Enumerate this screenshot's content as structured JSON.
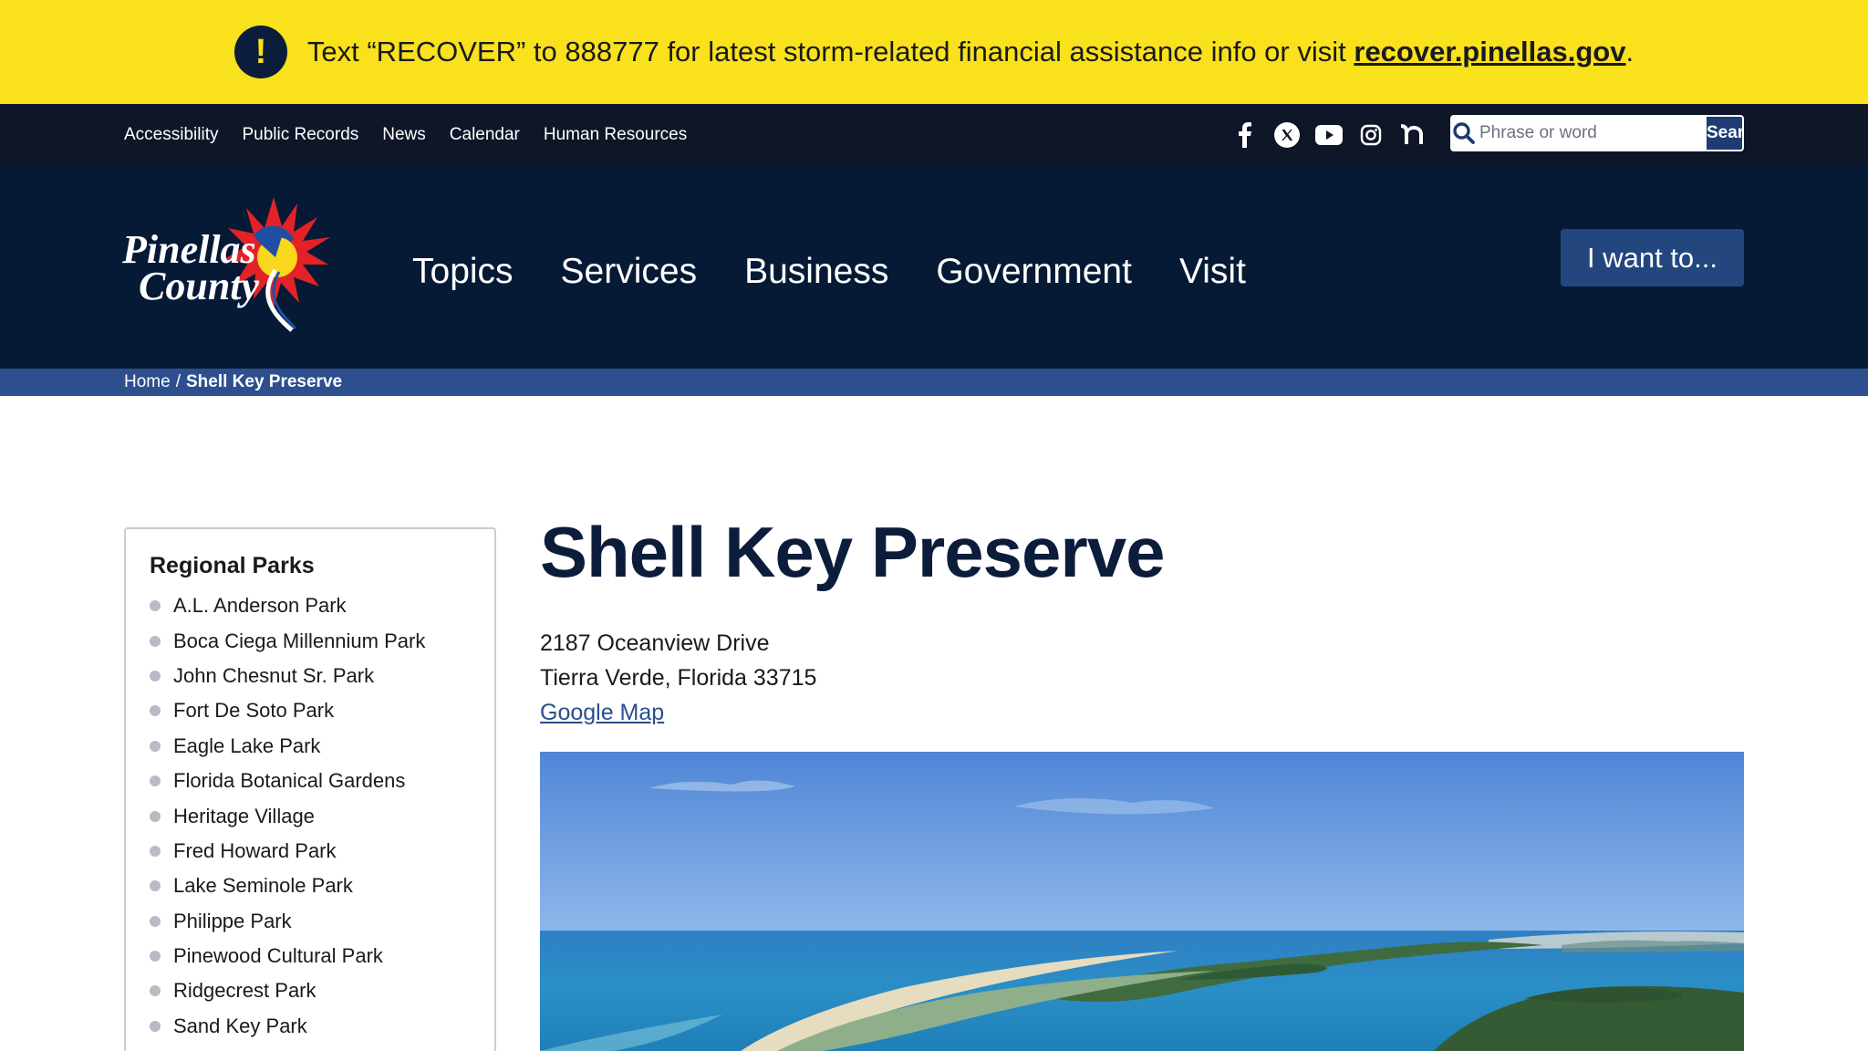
{
  "alert": {
    "icon": "exclamation-icon",
    "text": "Text “RECOVER” to 888777 for latest storm-related financial assistance info or visit ",
    "link": "recover.pinellas.gov",
    "suffix": ".",
    "bg_color": "#f9e11c"
  },
  "utility": {
    "links": [
      "Accessibility",
      "Public Records",
      "News",
      "Calendar",
      "Human Resources"
    ],
    "social_icons": [
      "facebook-icon",
      "x-icon",
      "youtube-icon",
      "instagram-icon",
      "nextdoor-icon"
    ],
    "search": {
      "placeholder": "Phrase or word",
      "button": "Search"
    }
  },
  "header": {
    "logo": {
      "line1": "Pinellas",
      "line2": "County"
    },
    "nav": [
      "Topics",
      "Services",
      "Business",
      "Government",
      "Visit"
    ],
    "cta": "I want to...",
    "bg_color": "#061a36"
  },
  "breadcrumb": {
    "home": "Home",
    "sep": "/",
    "current": "Shell Key Preserve"
  },
  "sidebar": {
    "heading": "Regional Parks",
    "items": [
      "A.L. Anderson Park",
      "Boca Ciega Millennium Park",
      "John Chesnut Sr. Park",
      "Fort De Soto Park",
      "Eagle Lake Park",
      "Florida Botanical Gardens",
      "Heritage Village",
      "Fred Howard Park",
      "Lake Seminole Park",
      "Philippe Park",
      "Pinewood Cultural Park",
      "Ridgecrest Park",
      "Sand Key Park"
    ]
  },
  "page": {
    "title": "Shell Key Preserve",
    "address_line1": "2187 Oceanview Drive",
    "address_line2": "Tierra Verde, Florida 33715",
    "map_link": "Google Map"
  }
}
